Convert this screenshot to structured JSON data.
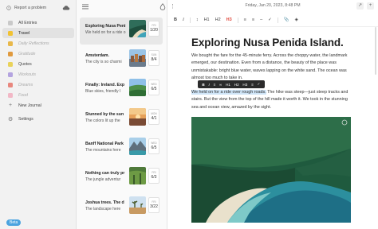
{
  "sidebar": {
    "report_label": "Report a problem",
    "items": [
      {
        "label": "All Entries",
        "color": "#c9c9c9"
      },
      {
        "label": "Travel",
        "color": "#f1c232",
        "active": true
      },
      {
        "label": "Daily Reflections",
        "color": "#e8b84a",
        "faded": true
      },
      {
        "label": "Gratitude",
        "color": "#e09a3e",
        "faded": true
      },
      {
        "label": "Quotes",
        "color": "#e9d25a"
      },
      {
        "label": "Workouts",
        "color": "#b4a4e0",
        "faded": true
      },
      {
        "label": "Dreams",
        "color": "#e8877e",
        "faded": true
      },
      {
        "label": "Food",
        "color": "#f2b8c6",
        "faded": true
      }
    ],
    "new_journal_label": "New Journal",
    "settings_label": "Settings",
    "beta_label": "Beta"
  },
  "entries": [
    {
      "title": "Exploring Nusa Peni",
      "snippet": "We held on for a ride o",
      "month": "FRI",
      "day": "1/20",
      "active": true
    },
    {
      "title": "Amsterdam.",
      "snippet": "The city is so charmi",
      "month": "SUN",
      "day": "8/4"
    },
    {
      "title": "Finally: Ireland. Exp",
      "snippet": "Blue skies, friendly l",
      "month": "WED",
      "day": "6/5"
    },
    {
      "title": "Stunned by the sun",
      "snippet": "The colors lit up the",
      "month": "MON",
      "day": "4/1"
    },
    {
      "title": "Banff National Park",
      "snippet": "The mountains here ",
      "month": "WED",
      "day": "6/5"
    },
    {
      "title": "Nothing can truly pr",
      "snippet": "The jungle adventur",
      "month": "FRI",
      "day": "6/3"
    },
    {
      "title": "Joshua trees. The d",
      "snippet": "The landscape here",
      "month": "FRI",
      "day": "3/22"
    }
  ],
  "editor": {
    "date_label": "Friday, Jan 20, 2023, 8:48 PM",
    "toolbar": {
      "bold": "B",
      "italic": "I",
      "h1": "H1",
      "h2": "H2",
      "h3": "H3"
    },
    "bubble": {
      "bold": "B",
      "italic": "I",
      "h1": "H1",
      "h2": "H2",
      "h3": "H3"
    },
    "title": "Exploring Nusa Penida Island.",
    "paragraph1": "We bought the fare for the 45-minute ferry. Across the choppy water, the landmark emerged, our destination. Even from a distance, the beauty of the place was unmistakable: bright blue water, waves lapping on the white sand. The ocean was almost too much to take in.",
    "paragraph2_highlight": "We held on for a ride over rough roads.",
    "paragraph2_rest": " The hike was steep—just steep tracks and stairs. But the view from the top of the hill made it worth it. We took in the stunning sea and ocean view, amazed by the sight."
  }
}
